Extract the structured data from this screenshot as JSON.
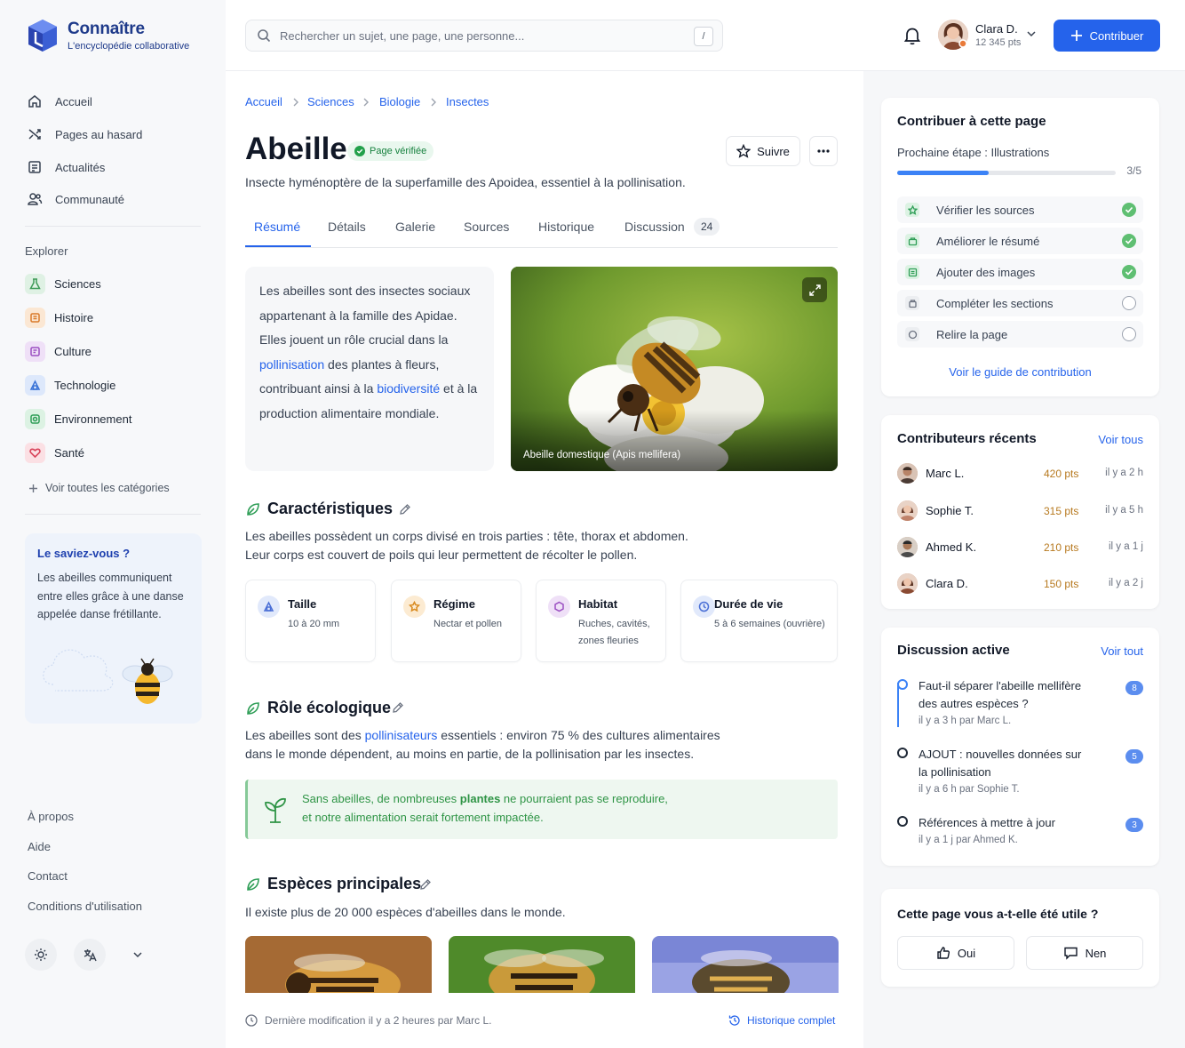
{
  "brand": {
    "name": "Connaître",
    "tagline": "L'encyclopédie collaborative"
  },
  "nav": [
    {
      "label": "Accueil",
      "icon": "home-icon"
    },
    {
      "label": "Pages au hasard",
      "icon": "shuffle-icon"
    },
    {
      "label": "Actualités",
      "icon": "news-icon"
    },
    {
      "label": "Communauté",
      "icon": "users-icon"
    }
  ],
  "explore": {
    "title": "Explorer",
    "categories": [
      {
        "label": "Sciences",
        "icon": "flask-icon",
        "color": "#3f9b57",
        "bg": "#dff1e4"
      },
      {
        "label": "Histoire",
        "icon": "scroll-icon",
        "color": "#d97a2b",
        "bg": "#fbe7d3"
      },
      {
        "label": "Culture",
        "icon": "palette-icon",
        "color": "#9b4fc2",
        "bg": "#efe0f7"
      },
      {
        "label": "Technologie",
        "icon": "chip-icon",
        "color": "#3b74d8",
        "bg": "#dde8fb"
      },
      {
        "label": "Environnement",
        "icon": "leaf-icon",
        "color": "#2f9e57",
        "bg": "#dcf2e3"
      },
      {
        "label": "Santé",
        "icon": "heart-icon",
        "color": "#d8435a",
        "bg": "#fbe0e4"
      }
    ],
    "all_label": "Voir toutes les catégories"
  },
  "tip": {
    "title": "Le saviez-vous ?",
    "text": "Les abeilles communiquent entre elles grâce à une danse appelée danse frétillante."
  },
  "footer_links": [
    "À propos",
    "Aide",
    "Contact",
    "Conditions d'utilisation"
  ],
  "search": {
    "placeholder": "Rechercher un sujet, une page, une personne...",
    "shortcut": "/"
  },
  "user": {
    "name": "Clara D.",
    "points": "12 345 pts"
  },
  "contribute_label": "Contribuer",
  "breadcrumb": [
    "Accueil",
    "Sciences",
    "Biologie",
    "Insectes"
  ],
  "article": {
    "title": "Abeille",
    "badge": "Page vérifiée",
    "follow_label": "Suivre",
    "subtitle": "Insecte hyménoptère de la superfamille des Apoidea, essentiel à la pollinisation.",
    "tabs": [
      "Résumé",
      "Détails",
      "Galerie",
      "Sources",
      "Historique",
      "Discussion"
    ],
    "discussion_count": "24",
    "summary": {
      "part1": "Les abeilles sont des insectes sociaux appartenant à la famille des Apidae. Elles jouent un rôle crucial dans la ",
      "link1": "pollinisation",
      "part2": " des plantes à fleurs, contribuant ainsi à la ",
      "link2": "biodiversité",
      "part3": " et à la production alimentaire mondiale."
    },
    "image_caption": "Abeille domestique (Apis mellifera)",
    "characteristics": {
      "title": "Caractéristiques",
      "text1": "Les abeilles possèdent un corps divisé en trois parties : tête, thorax et abdomen.",
      "text2": "Leur corps est couvert de poils qui leur permettent de récolter le pollen.",
      "facts": [
        {
          "label": "Taille",
          "value": "10 à 20 mm",
          "icon": "ruler-icon",
          "color": "#4a6fd6",
          "bg": "#e1e9fb"
        },
        {
          "label": "Régime",
          "value": "Nectar et pollen",
          "icon": "flower-icon",
          "color": "#d98a1e",
          "bg": "#fcebd2"
        },
        {
          "label": "Habitat",
          "value": "Ruches, cavités, zones fleuries",
          "icon": "hive-icon",
          "color": "#9b4fc2",
          "bg": "#efe0f7"
        },
        {
          "label": "Durée de vie",
          "value": "5 à 6 semaines (ouvrière)",
          "icon": "clock-icon",
          "color": "#4a6fd6",
          "bg": "#e1e9fb"
        }
      ]
    },
    "ecology": {
      "title": "Rôle écologique",
      "part1": "Les abeilles sont des ",
      "link": "pollinisateurs",
      "part2": " essentiels : environ 75 % des cultures alimentaires",
      "line2": "dans le monde dépendent, au moins en partie, de la pollinisation par les insectes.",
      "quote1a": "Sans abeilles, de nombreuses ",
      "quote1b": "plantes",
      "quote1c": " ne pourraient pas se reproduire,",
      "quote2": "et notre alimentation serait fortement impactée."
    },
    "species": {
      "title": "Espèces principales",
      "text": "Il existe plus de 20 000 espèces d'abeilles dans le monde."
    },
    "last_modified": "Dernière modification il y a 2 heures par Marc L.",
    "history_label": "Historique complet"
  },
  "contribute_panel": {
    "title": "Contribuer à cette page",
    "next_step": "Prochaine étape : Illustrations",
    "progress_label": "3/5",
    "progress": 0.42,
    "steps": [
      {
        "label": "Vérifier les sources",
        "done": true,
        "icon": "star-icon"
      },
      {
        "label": "Améliorer le résumé",
        "done": true,
        "icon": "edit-icon"
      },
      {
        "label": "Ajouter des images",
        "done": true,
        "icon": "image-icon"
      },
      {
        "label": "Compléter les sections",
        "done": false,
        "icon": "list-icon"
      },
      {
        "label": "Relire la page",
        "done": false,
        "icon": "circle-icon"
      }
    ],
    "guide_link": "Voir le guide de contribution"
  },
  "contributors": {
    "title": "Contributeurs récents",
    "see_all": "Voir tous",
    "list": [
      {
        "name": "Marc L.",
        "points": "420 pts",
        "time": "il y a 2 h"
      },
      {
        "name": "Sophie T.",
        "points": "315 pts",
        "time": "il y a 5 h"
      },
      {
        "name": "Ahmed K.",
        "points": "210 pts",
        "time": "il y a 1 j"
      },
      {
        "name": "Clara D.",
        "points": "150 pts",
        "time": "il y a 2 j"
      }
    ]
  },
  "discussions": {
    "title": "Discussion active",
    "see_all": "Voir tout",
    "list": [
      {
        "title": "Faut-il séparer l'abeille mellifère des autres espèces ?",
        "time": "il y a 3 h par ",
        "author": "Marc L.",
        "count": "8"
      },
      {
        "title": "AJOUT : nouvelles données sur la pollinisation",
        "time": "il y a 6 h par ",
        "author": "Sophie T.",
        "count": "5"
      },
      {
        "title": "Références à mettre à jour",
        "time": "il y a 1 j par ",
        "author": "Ahmed K.",
        "count": "3"
      }
    ]
  },
  "feedback": {
    "question": "Cette page vous a-t-elle été utile ?",
    "yes": "Oui",
    "no": "Nen"
  }
}
